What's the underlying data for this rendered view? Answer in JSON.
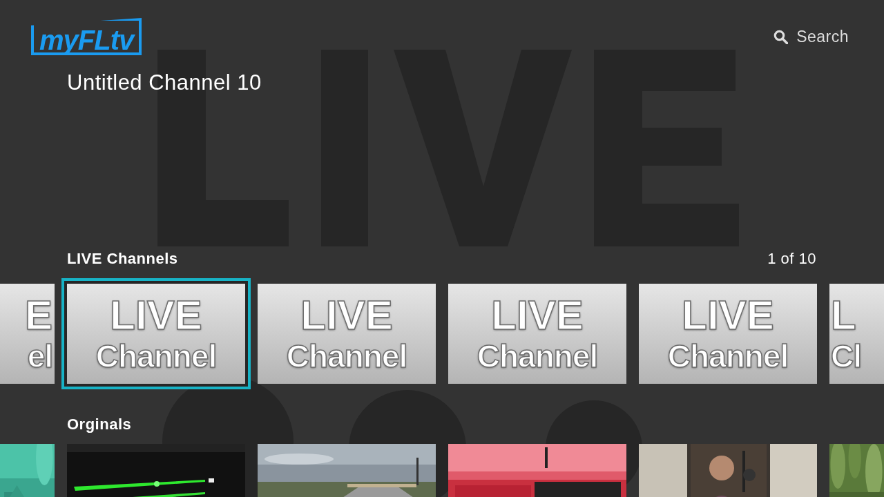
{
  "header": {
    "logo": {
      "text": "myFLtv"
    },
    "search": {
      "label": "Search"
    }
  },
  "title": "Untitled Channel 10",
  "rows": [
    {
      "kind": "text-tiles",
      "title": "LIVE Channels",
      "counter": "1 of 10",
      "items": [
        {
          "lines": [
            "E",
            "el"
          ],
          "kind": "partial-start",
          "selected": false
        },
        {
          "lines": [
            "LIVE",
            "Channel"
          ],
          "kind": "full",
          "selected": true
        },
        {
          "lines": [
            "LIVE",
            "Channel"
          ],
          "kind": "full",
          "selected": false
        },
        {
          "lines": [
            "LIVE",
            "Channel"
          ],
          "kind": "full",
          "selected": false
        },
        {
          "lines": [
            "LIVE",
            "Channel"
          ],
          "kind": "full",
          "selected": false
        },
        {
          "lines": [
            "L",
            "Cl"
          ],
          "kind": "partial-end",
          "selected": false
        }
      ]
    },
    {
      "kind": "pictures",
      "title": "Orginals"
    }
  ]
}
